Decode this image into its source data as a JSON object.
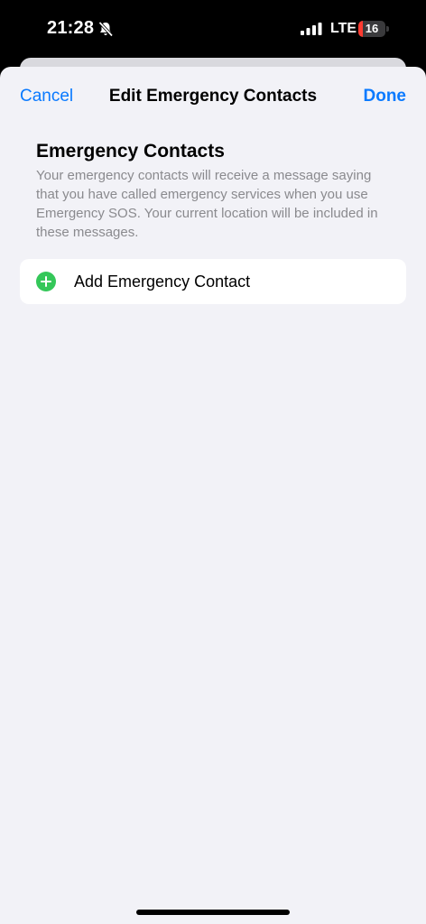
{
  "status_bar": {
    "time": "21:28",
    "network": "LTE",
    "battery_level": 16,
    "battery_label": "16",
    "silent_icon": "bell-slash-icon",
    "signal_icon": "cellular-signal-icon",
    "battery_color": "#ff3b30"
  },
  "nav": {
    "cancel_label": "Cancel",
    "title": "Edit Emergency Contacts",
    "done_label": "Done",
    "accent_color": "#0a7aff"
  },
  "section": {
    "header": "Emergency Contacts",
    "footer": "Your emergency contacts will receive a message saying that you have called emergency services when you use Emergency SOS. Your current location will be included in these messages."
  },
  "list": {
    "add_label": "Add Emergency Contact",
    "add_icon": "plus-circle-icon",
    "add_icon_color": "#34c759"
  }
}
